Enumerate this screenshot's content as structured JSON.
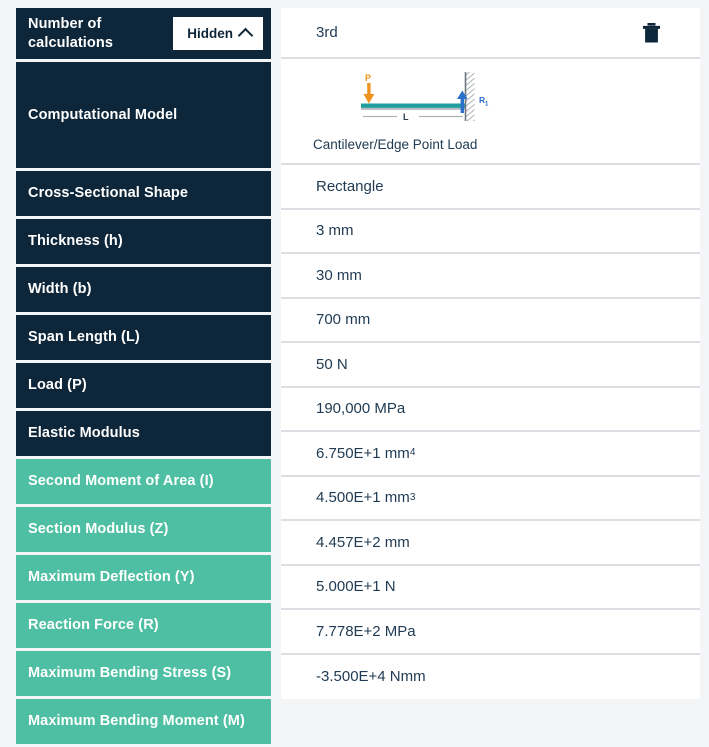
{
  "panel": {
    "header": {
      "label": "Number of calculations",
      "toggle_label": "Hidden",
      "toggle_icon": "chevron-up-icon",
      "value": "3rd",
      "delete_icon": "trash-icon"
    },
    "model_row": {
      "label": "Computational Model",
      "diagram_caption": "Cantilever/Edge Point Load",
      "diagram": {
        "load_label": "P",
        "span_label": "L",
        "reaction_label": "R",
        "reaction_sub": "1"
      }
    },
    "rows": [
      {
        "label": "Cross-Sectional Shape",
        "value": "Rectangle",
        "style": "navy"
      },
      {
        "label": "Thickness (h)",
        "value": "3 mm",
        "style": "navy"
      },
      {
        "label": "Width (b)",
        "value": "30 mm",
        "style": "navy"
      },
      {
        "label": "Span Length (L)",
        "value": "700 mm",
        "style": "navy"
      },
      {
        "label": "Load (P)",
        "value": "50 N",
        "style": "navy"
      },
      {
        "label": "Elastic Modulus",
        "value": "190,000 MPa",
        "style": "navy"
      },
      {
        "label": "Second Moment of Area (I)",
        "value": "6.750E+1 mm",
        "sup": "4",
        "style": "teal"
      },
      {
        "label": "Section Modulus (Z)",
        "value": "4.500E+1 mm",
        "sup": "3",
        "style": "teal"
      },
      {
        "label": "Maximum Deflection (Y)",
        "value": "4.457E+2 mm",
        "style": "teal"
      },
      {
        "label": "Reaction Force (R)",
        "value": "5.000E+1 N",
        "style": "teal"
      },
      {
        "label": "Maximum Bending Stress (S)",
        "value": "7.778E+2 MPa",
        "style": "teal"
      },
      {
        "label": "Maximum Bending Moment (M)",
        "value": "-3.500E+4 Nmm",
        "style": "teal"
      }
    ]
  },
  "colors": {
    "navy": "#0d2639",
    "teal": "#4fbfa4",
    "page_bg": "#f4f5f7",
    "value_text": "#1f3a52",
    "load_arrow": "#f0921e",
    "beam": "#1f9e9e",
    "reaction_arrow": "#2a6fc9"
  }
}
